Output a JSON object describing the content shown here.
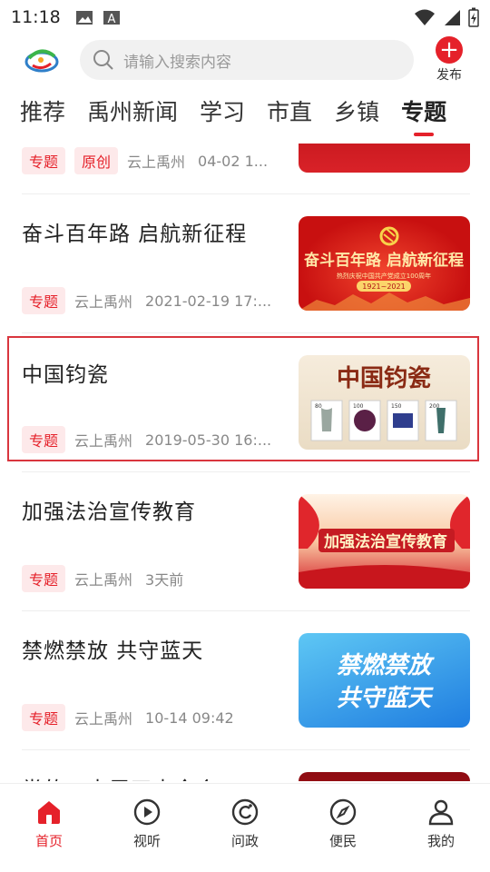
{
  "status_bar": {
    "time": "11:18"
  },
  "header": {
    "search_placeholder": "请输入搜索内容",
    "publish_label": "发布"
  },
  "tabs": [
    {
      "label": "推荐",
      "active": false
    },
    {
      "label": "禹州新闻",
      "active": false
    },
    {
      "label": "学习",
      "active": false
    },
    {
      "label": "市直",
      "active": false
    },
    {
      "label": "乡镇",
      "active": false
    },
    {
      "label": "专题",
      "active": true
    }
  ],
  "feed": [
    {
      "title": "",
      "tags": [
        "专题",
        "原创"
      ],
      "source": "云上禹州",
      "time": "04-02 1...",
      "thumb_text": ""
    },
    {
      "title": "奋斗百年路 启航新征程",
      "tags": [
        "专题"
      ],
      "source": "云上禹州",
      "time": "2021-02-19 17:...",
      "thumb_text": "奋斗百年路 启航新征程",
      "thumb_sub": "热烈庆祝中国共产党成立100周年",
      "thumb_years": "1921~2021"
    },
    {
      "title": "中国钧瓷",
      "tags": [
        "专题"
      ],
      "source": "云上禹州",
      "time": "2019-05-30 16:...",
      "thumb_text": "中国钧瓷",
      "stamp_values": [
        "80",
        "100",
        "150",
        "200"
      ]
    },
    {
      "title": "加强法治宣传教育",
      "tags": [
        "专题"
      ],
      "source": "云上禹州",
      "time": "3天前",
      "thumb_text": "加强法治宣传教育"
    },
    {
      "title": "禁燃禁放 共守蓝天",
      "tags": [
        "专题"
      ],
      "source": "云上禹州",
      "time": "10-14 09:42",
      "thumb_text_1": "禁燃禁放",
      "thumb_text_2": "共守蓝天"
    },
    {
      "title": "党的二十届四中全会",
      "tags": [],
      "source": "",
      "time": "",
      "thumb_text": ""
    }
  ],
  "bottom_nav": [
    {
      "label": "首页",
      "icon": "home-icon",
      "active": true
    },
    {
      "label": "视听",
      "icon": "play-icon",
      "active": false
    },
    {
      "label": "问政",
      "icon": "question-icon",
      "active": false
    },
    {
      "label": "便民",
      "icon": "compass-icon",
      "active": false
    },
    {
      "label": "我的",
      "icon": "user-icon",
      "active": false
    }
  ],
  "colors": {
    "accent": "#e5212a",
    "tag_bg": "#fde9ea",
    "meta_text": "#888888"
  }
}
